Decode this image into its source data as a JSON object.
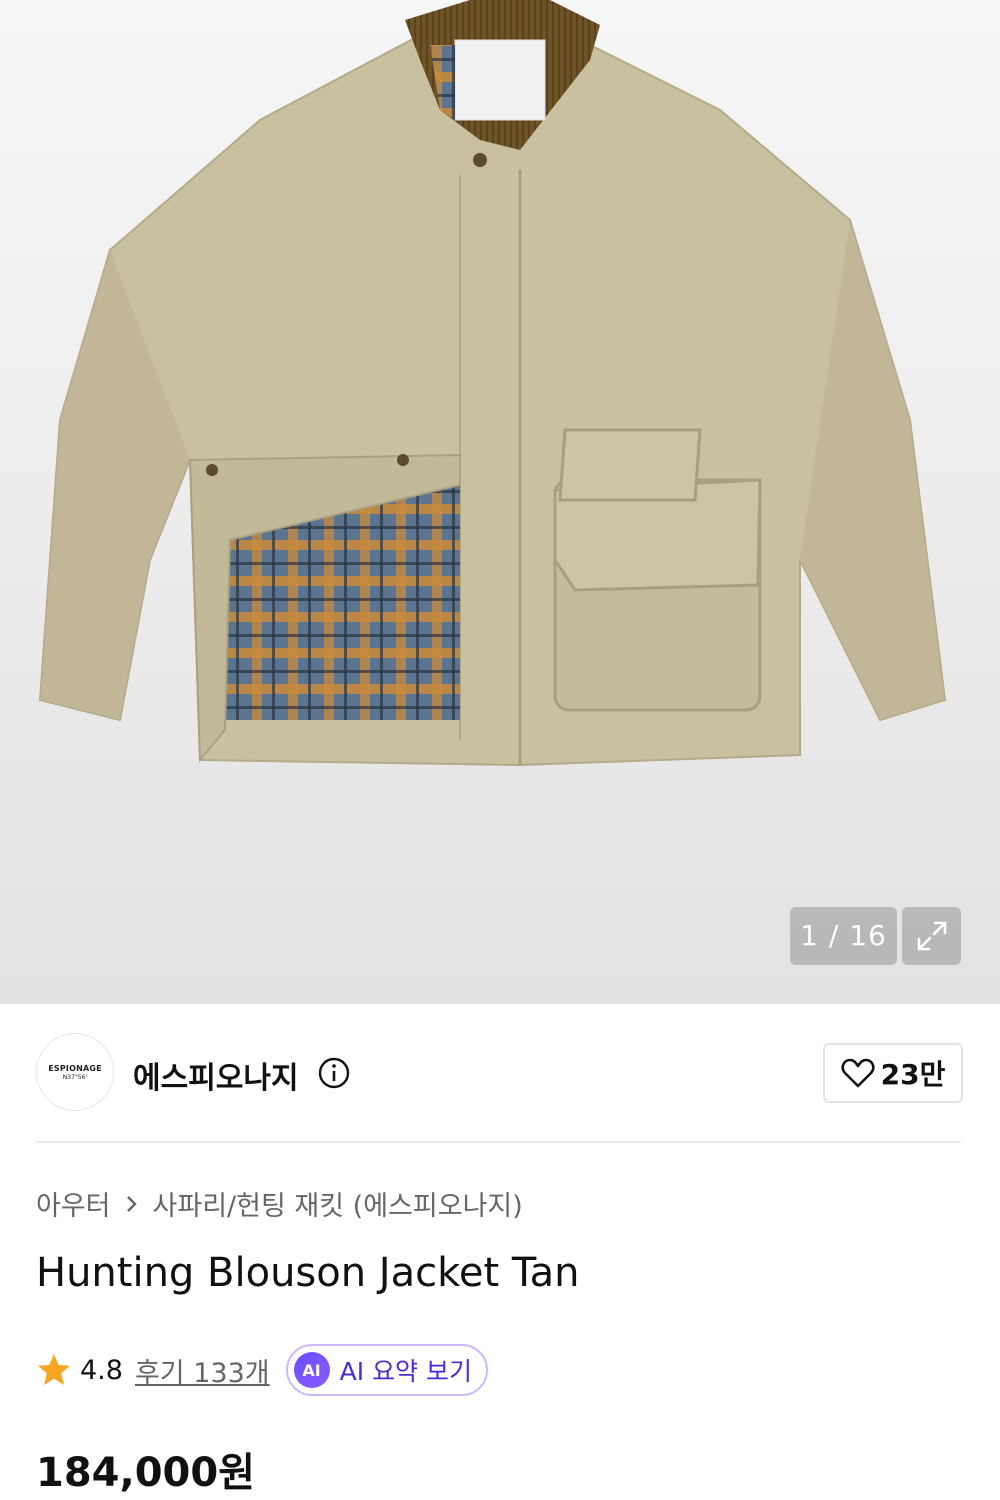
{
  "gallery": {
    "current": "1 / 16",
    "expand_icon": "expand-icon",
    "product_image": "tan-hunting-jacket-photo"
  },
  "brand": {
    "logo_line1": "ESPIONAGE",
    "logo_line2": "N37°56'",
    "name": "에스피오나지",
    "info_icon": "info-icon"
  },
  "like": {
    "icon": "heart-icon",
    "count": "23만"
  },
  "breadcrumb": {
    "category": "아우터",
    "separator_icon": "chevron-right-icon",
    "subcategory": "사파리/헌팅 재킷 (에스피오나지)"
  },
  "product": {
    "title": "Hunting Blouson Jacket Tan",
    "rating": "4.8",
    "review_link": "후기 133개",
    "ai_badge": "AI",
    "ai_summary_label": "AI 요약 보기",
    "price": "184,000원"
  },
  "colors": {
    "jacket": "#c9c0a0",
    "collar": "#6e5326",
    "star": "#f5a623",
    "ai_accent": "#5b3cf0"
  }
}
